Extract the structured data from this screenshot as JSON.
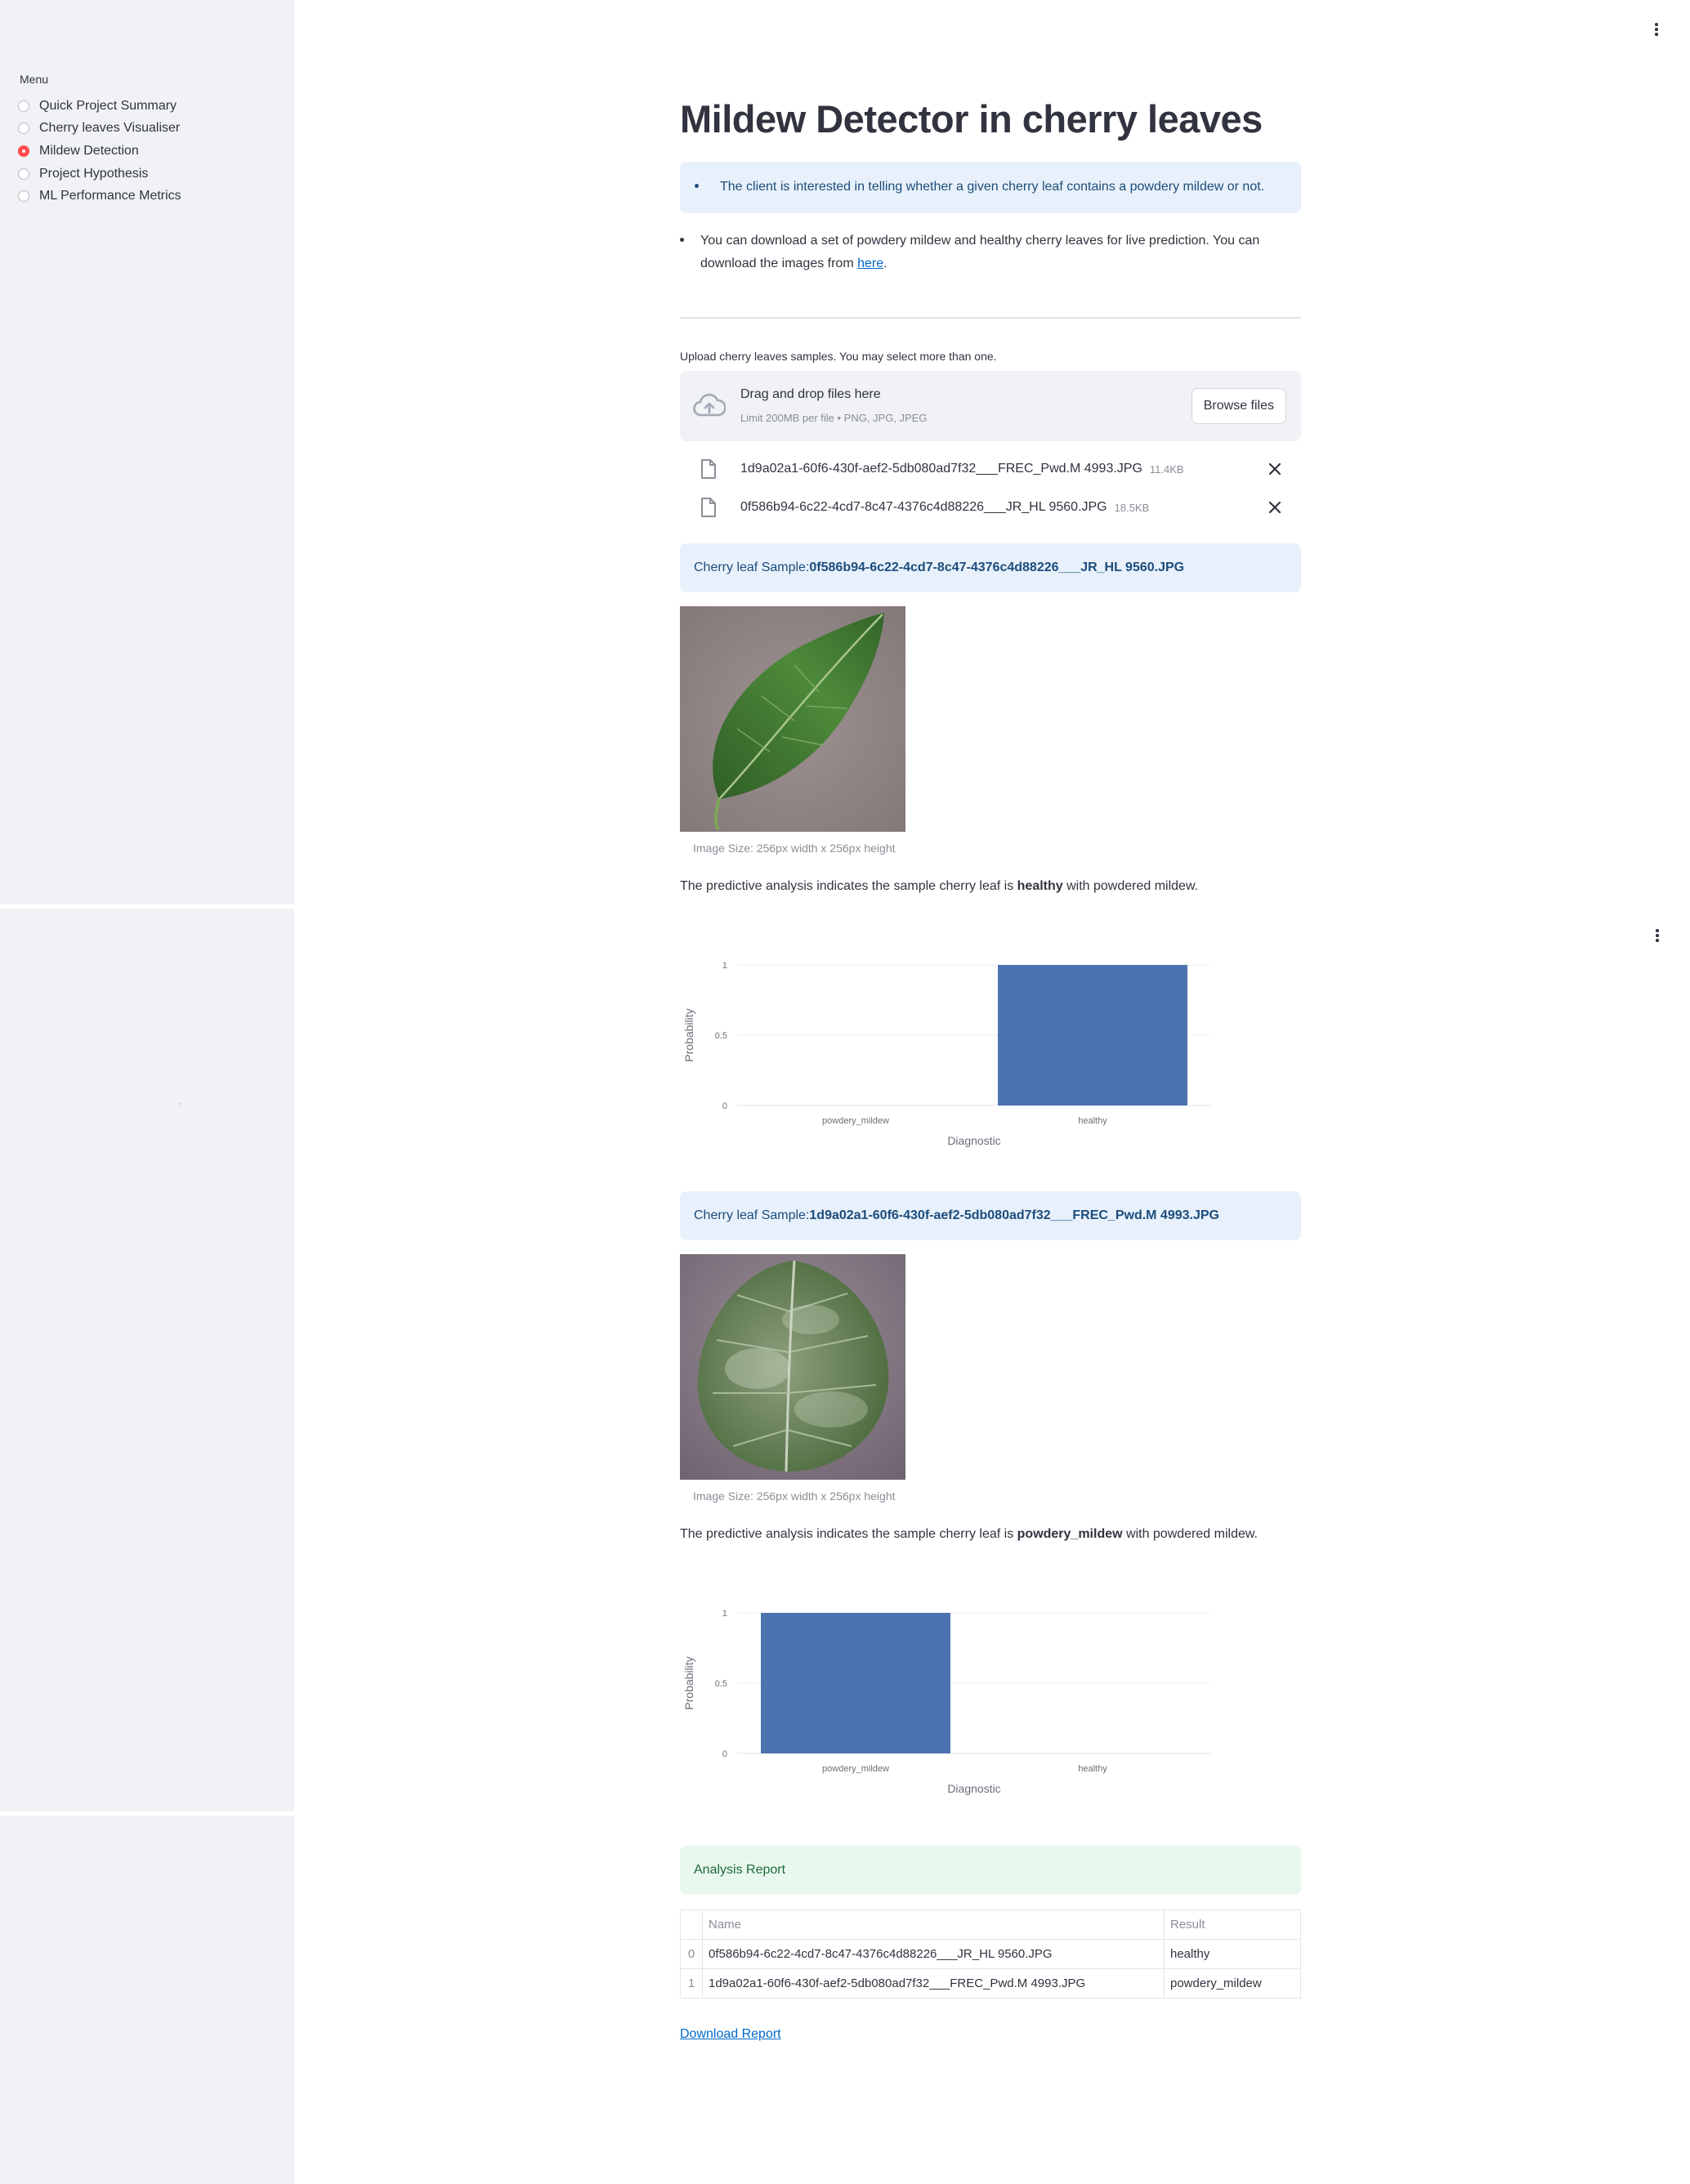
{
  "sidebar": {
    "menu_label": "Menu",
    "items": [
      {
        "label": "Quick Project Summary",
        "selected": false
      },
      {
        "label": "Cherry leaves Visualiser",
        "selected": false
      },
      {
        "label": "Mildew Detection",
        "selected": true
      },
      {
        "label": "Project Hypothesis",
        "selected": false
      },
      {
        "label": "ML Performance Metrics",
        "selected": false
      }
    ]
  },
  "main": {
    "title": "Mildew Detector in cherry leaves",
    "info_text": "The client is interested in telling whether a given cherry leaf contains a powdery mildew or not.",
    "download_text_prefix": "You can download a set of powdery mildew and healthy cherry leaves for live prediction. You can download the images from ",
    "download_link": "here",
    "download_text_suffix": ".",
    "uploader": {
      "label": "Upload cherry leaves samples. You may select more than one.",
      "drag_text": "Drag and drop files here",
      "limit_text": "Limit 200MB per file • PNG, JPG, JPEG",
      "browse_label": "Browse files",
      "files": [
        {
          "name": "1d9a02a1-60f6-430f-aef2-5db080ad7f32___FREC_Pwd.M 4993.JPG",
          "size": "11.4KB"
        },
        {
          "name": "0f586b94-6c22-4cd7-8c47-4376c4d88226___JR_HL 9560.JPG",
          "size": "18.5KB"
        }
      ]
    },
    "samples": [
      {
        "label_prefix": "Cherry leaf Sample: ",
        "filename": "0f586b94-6c22-4cd7-8c47-4376c4d88226___JR_HL 9560.JPG",
        "caption": "Image Size: 256px width x 256px height",
        "result_prefix": "The predictive analysis indicates the sample cherry leaf is ",
        "result": "healthy",
        "result_suffix": " with powdered mildew."
      },
      {
        "label_prefix": "Cherry leaf Sample: ",
        "filename": "1d9a02a1-60f6-430f-aef2-5db080ad7f32___FREC_Pwd.M 4993.JPG",
        "caption": "Image Size: 256px width x 256px height",
        "result_prefix": "The predictive analysis indicates the sample cherry leaf is ",
        "result": "powdery_mildew",
        "result_suffix": " with powdered mildew."
      }
    ],
    "report": {
      "title": "Analysis Report",
      "columns": [
        "",
        "Name",
        "Result"
      ],
      "rows": [
        [
          "0",
          "0f586b94-6c22-4cd7-8c47-4376c4d88226___JR_HL 9560.JPG",
          "healthy"
        ],
        [
          "1",
          "1d9a02a1-60f6-430f-aef2-5db080ad7f32___FREC_Pwd.M 4993.JPG",
          "powdery_mildew"
        ]
      ],
      "download_label": "Download Report"
    }
  },
  "colors": {
    "accent": "#ff4b4b",
    "bar": "#4c72b0",
    "info_bg": "#e8f1fb",
    "success_bg": "#e9f8ee"
  },
  "chart_data": [
    {
      "type": "bar",
      "categories": [
        "powdery_mildew",
        "healthy"
      ],
      "values": [
        0,
        1
      ],
      "xlabel": "Diagnostic",
      "ylabel": "Probability",
      "yticks": [
        "0",
        "0.5",
        "1"
      ],
      "ylim": [
        0,
        1
      ]
    },
    {
      "type": "bar",
      "categories": [
        "powdery_mildew",
        "healthy"
      ],
      "values": [
        1,
        0
      ],
      "xlabel": "Diagnostic",
      "ylabel": "Probability",
      "yticks": [
        "0",
        "0.5",
        "1"
      ],
      "ylim": [
        0,
        1
      ]
    }
  ]
}
